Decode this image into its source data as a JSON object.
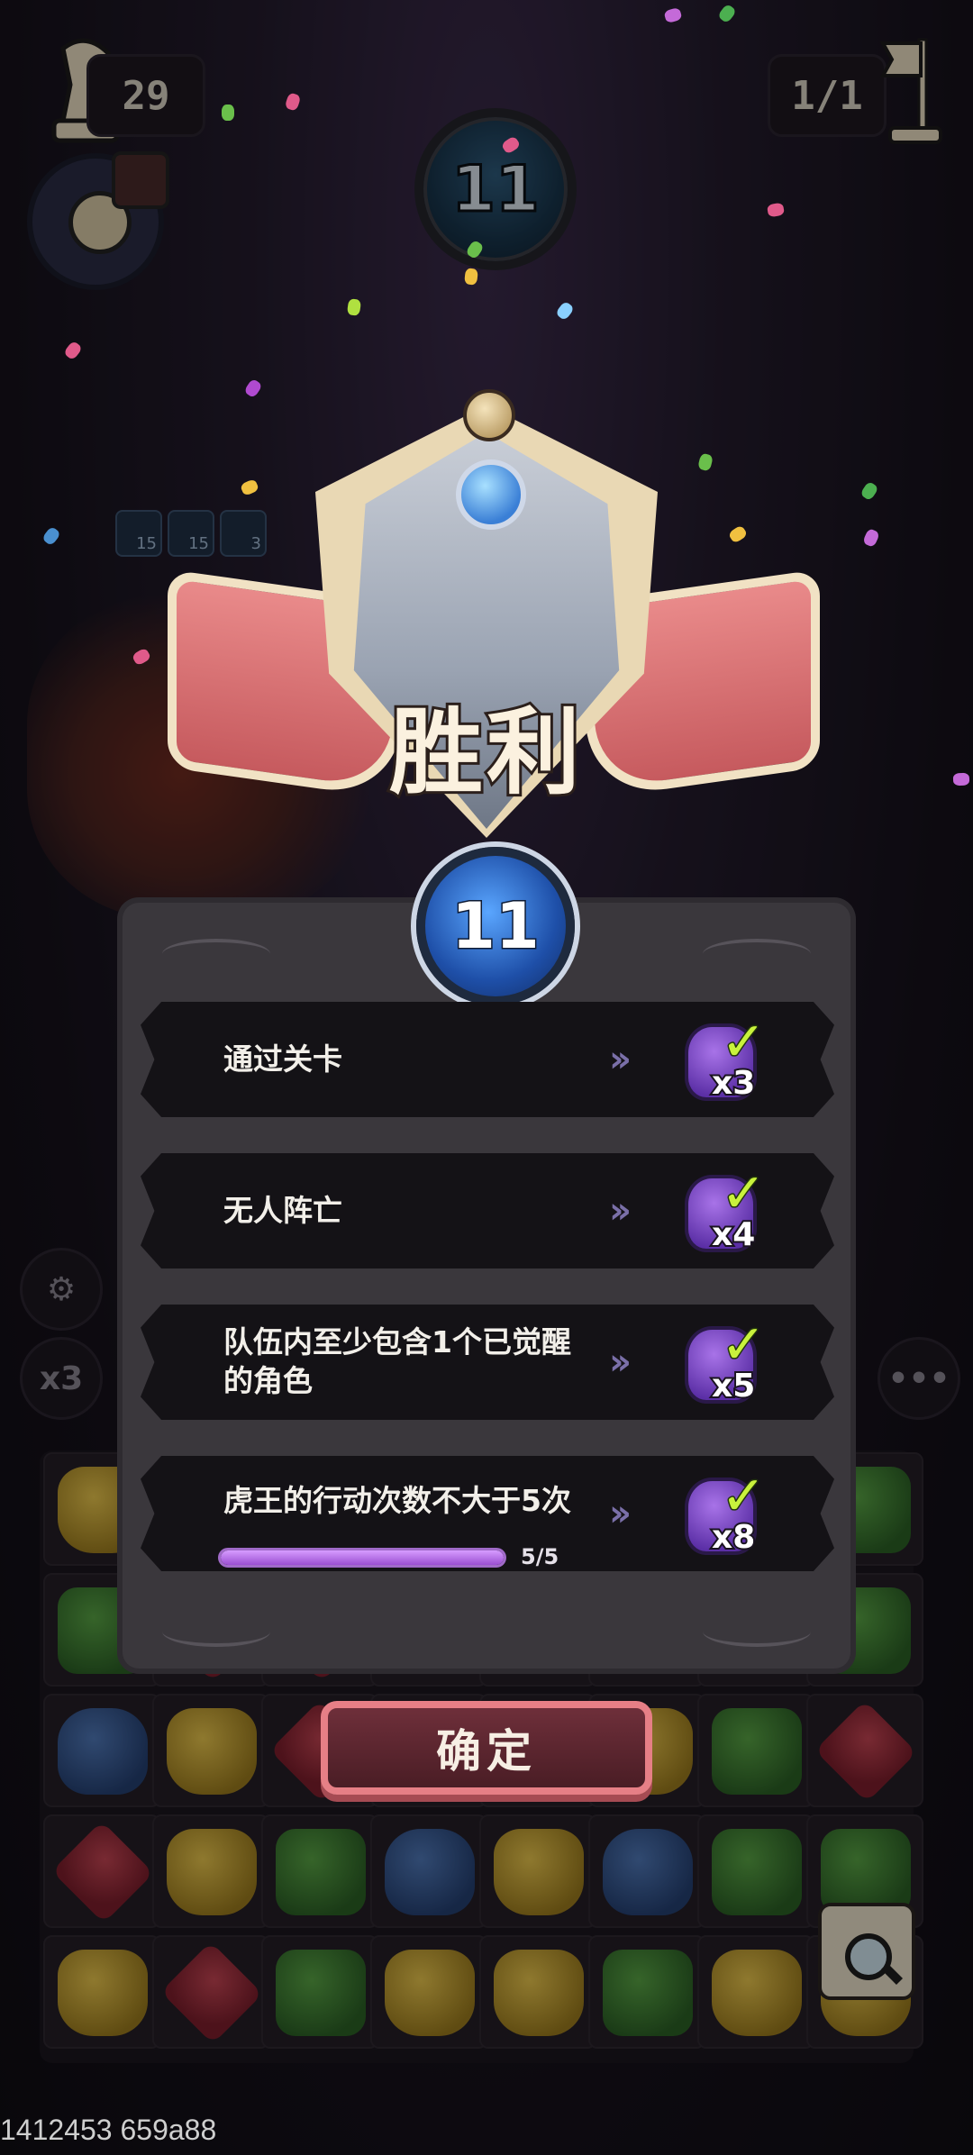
{
  "hud": {
    "moves": "29",
    "round": "1/1",
    "turn": "11"
  },
  "status_effects": [
    "15",
    "15",
    "3"
  ],
  "victory": {
    "title": "胜利",
    "level": "11",
    "objectives": [
      {
        "text": "通过关卡",
        "reward_qty": "x3"
      },
      {
        "text": "无人阵亡",
        "reward_qty": "x4"
      },
      {
        "text": "队伍内至少包含1个已觉醒的角色",
        "reward_qty": "x5"
      },
      {
        "text": "虎王的行动次数不大于5次",
        "reward_qty": "x8",
        "progress_label": "5/5",
        "progress": 1.0
      }
    ],
    "arrow": "»",
    "confirm_label": "确定"
  },
  "side": {
    "speed_label": "x3",
    "more_label": "•••"
  },
  "board": {
    "rows": [
      [
        "yellow",
        "yellow",
        "yellow",
        "blue",
        "green",
        "yellow",
        "green",
        "green"
      ],
      [
        "green",
        "red",
        "red",
        "blue",
        "green",
        "yellow",
        "green",
        "green"
      ],
      [
        "blue",
        "yellow",
        "red",
        "blue",
        "green",
        "yellow",
        "green",
        "red"
      ],
      [
        "red",
        "yellow",
        "green",
        "blue",
        "yellow",
        "blue",
        "green",
        "green"
      ],
      [
        "yellow",
        "red",
        "green",
        "yellow",
        "yellow",
        "green",
        "yellow",
        "yellow"
      ]
    ]
  },
  "footer_text": "1412453 659a88",
  "colors": {
    "accent_purple": "#9b4fd1",
    "check_green": "#c9f23c",
    "confirm_border": "#e67f86"
  }
}
